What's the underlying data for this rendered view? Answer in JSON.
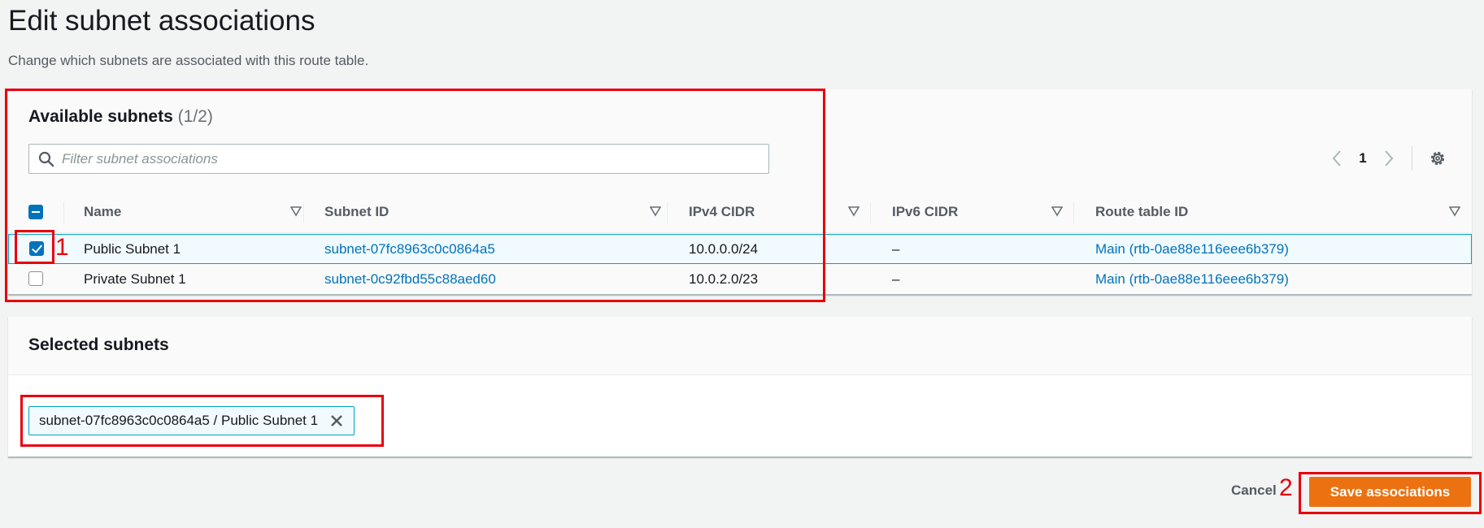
{
  "page": {
    "title": "Edit subnet associations",
    "description": "Change which subnets are associated with this route table."
  },
  "available": {
    "heading": "Available subnets",
    "count": "(1/2)",
    "search_placeholder": "Filter subnet associations",
    "page_number": "1",
    "columns": [
      "Name",
      "Subnet ID",
      "IPv4 CIDR",
      "IPv6 CIDR",
      "Route table ID"
    ],
    "rows": [
      {
        "name": "Public Subnet 1",
        "subnet_id": "subnet-07fc8963c0c0864a5",
        "ipv4": "10.0.0.0/24",
        "ipv6": "–",
        "route_table": "Main (rtb-0ae88e116eee6b379)",
        "checked": true
      },
      {
        "name": "Private Subnet 1",
        "subnet_id": "subnet-0c92fbd55c88aed60",
        "ipv4": "10.0.2.0/23",
        "ipv6": "–",
        "route_table": "Main (rtb-0ae88e116eee6b379)",
        "checked": false
      }
    ]
  },
  "selected": {
    "heading": "Selected subnets",
    "tokens": [
      "subnet-07fc8963c0c0864a5 / Public Subnet 1"
    ]
  },
  "actions": {
    "cancel": "Cancel",
    "save": "Save associations"
  },
  "annotations": {
    "step1": "1",
    "step2": "2"
  },
  "colors": {
    "accent": "#0073bb",
    "primary_button": "#ec7211",
    "annotation": "#e8000b"
  }
}
